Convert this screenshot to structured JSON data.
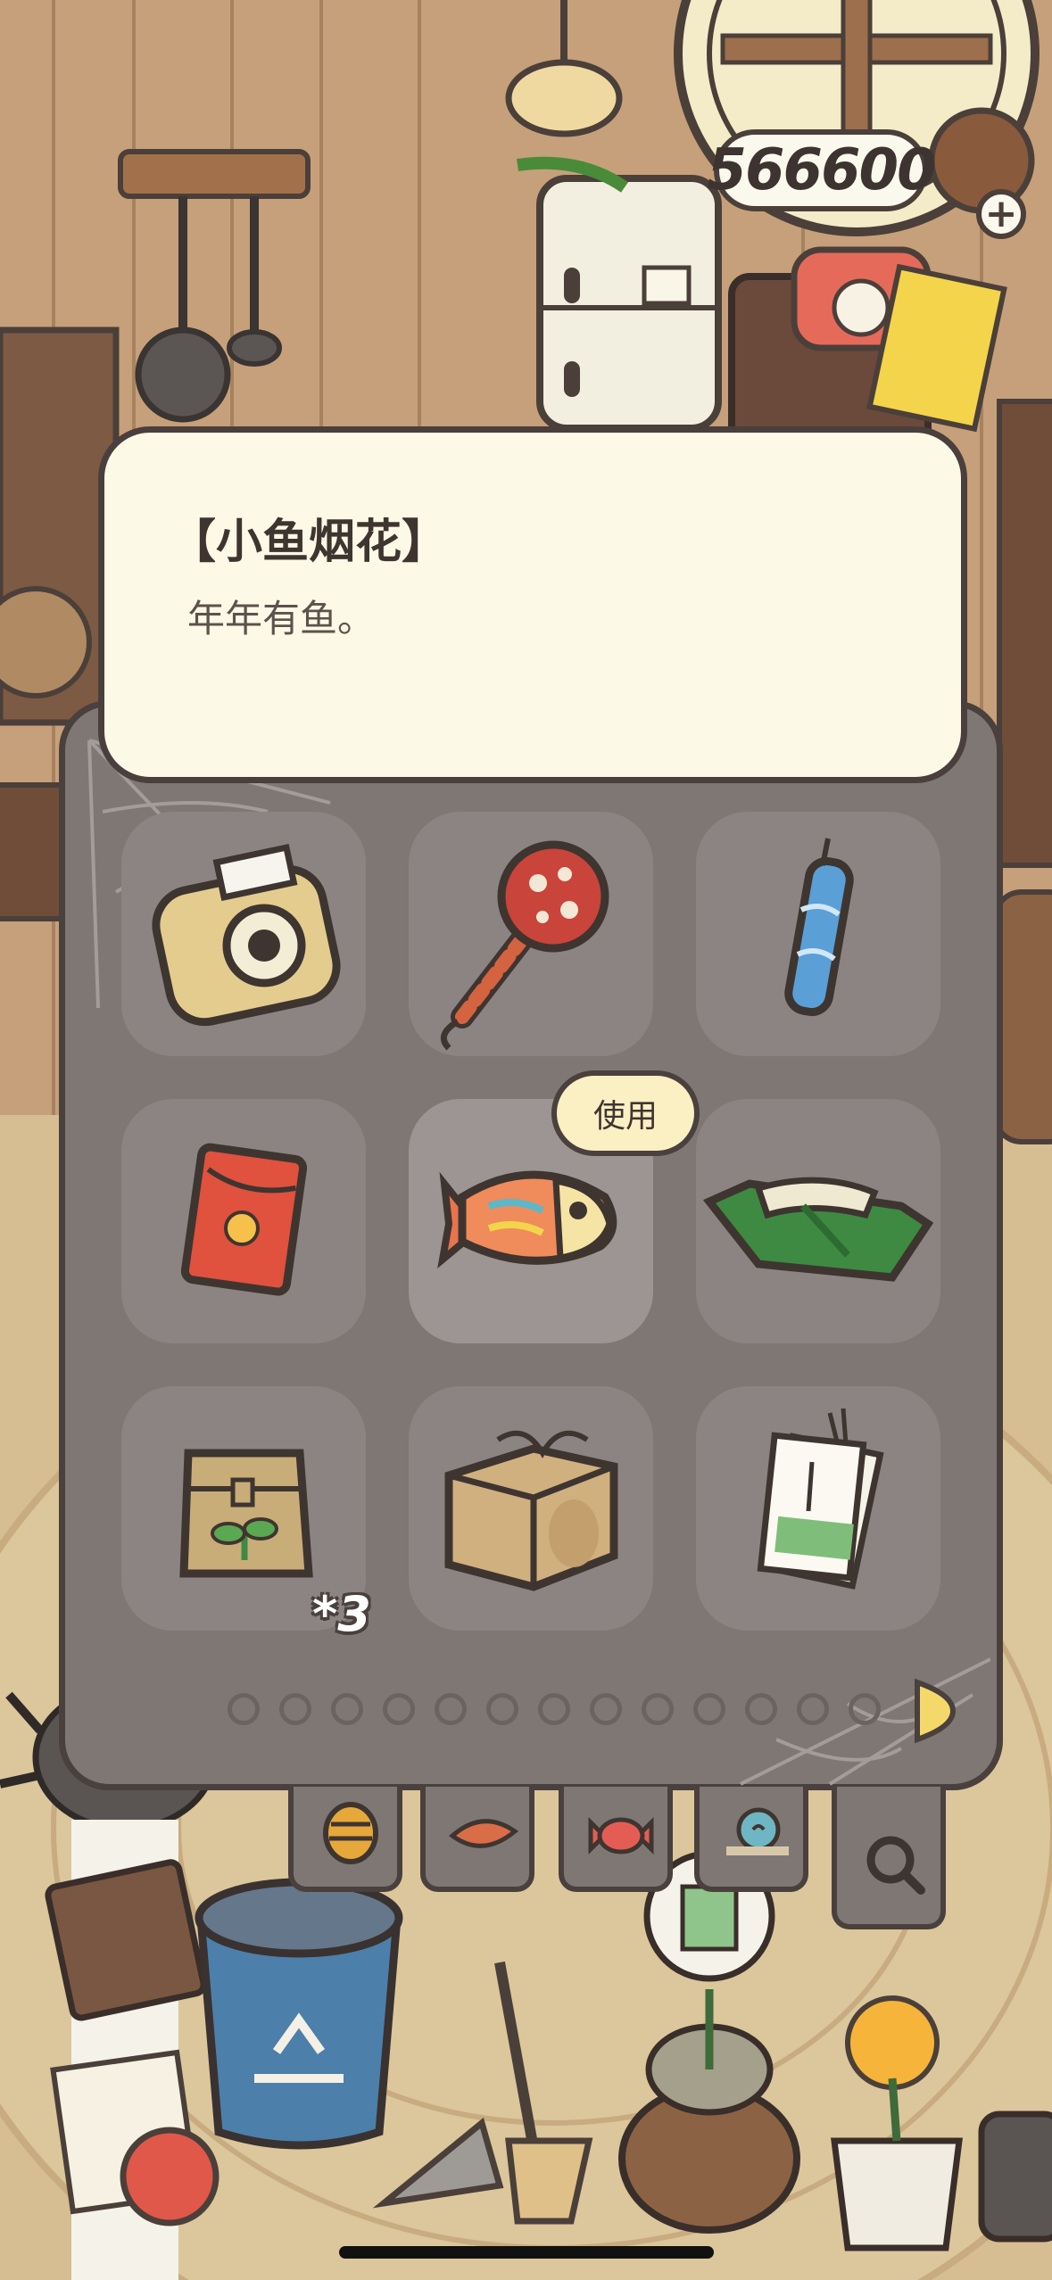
{
  "currency": {
    "amount": "566600",
    "add_label": "+"
  },
  "item_detail": {
    "title": "【小鱼烟花】",
    "description": "年年有鱼。"
  },
  "inventory": {
    "items": [
      {
        "name": "instant-camera-icon"
      },
      {
        "name": "maraca-icon"
      },
      {
        "name": "firecracker-stick-icon"
      },
      {
        "name": "red-envelope-icon"
      },
      {
        "name": "fish-firework-icon",
        "selected": true
      },
      {
        "name": "green-bundle-icon"
      },
      {
        "name": "seed-bag-icon",
        "count": "*3"
      },
      {
        "name": "cardboard-box-icon"
      },
      {
        "name": "paper-charm-icon"
      }
    ],
    "use_button_label": "使用",
    "page_count": 13
  },
  "tabs": [
    {
      "name": "tab-pinecone-icon"
    },
    {
      "name": "tab-leaf-icon"
    },
    {
      "name": "tab-candy-icon"
    },
    {
      "name": "tab-snail-icon"
    },
    {
      "name": "tab-search-icon"
    }
  ],
  "colors": {
    "panel": "#7f7774",
    "card": "#fcf9e6",
    "outline": "#4a403d",
    "button": "#fbefc4"
  }
}
